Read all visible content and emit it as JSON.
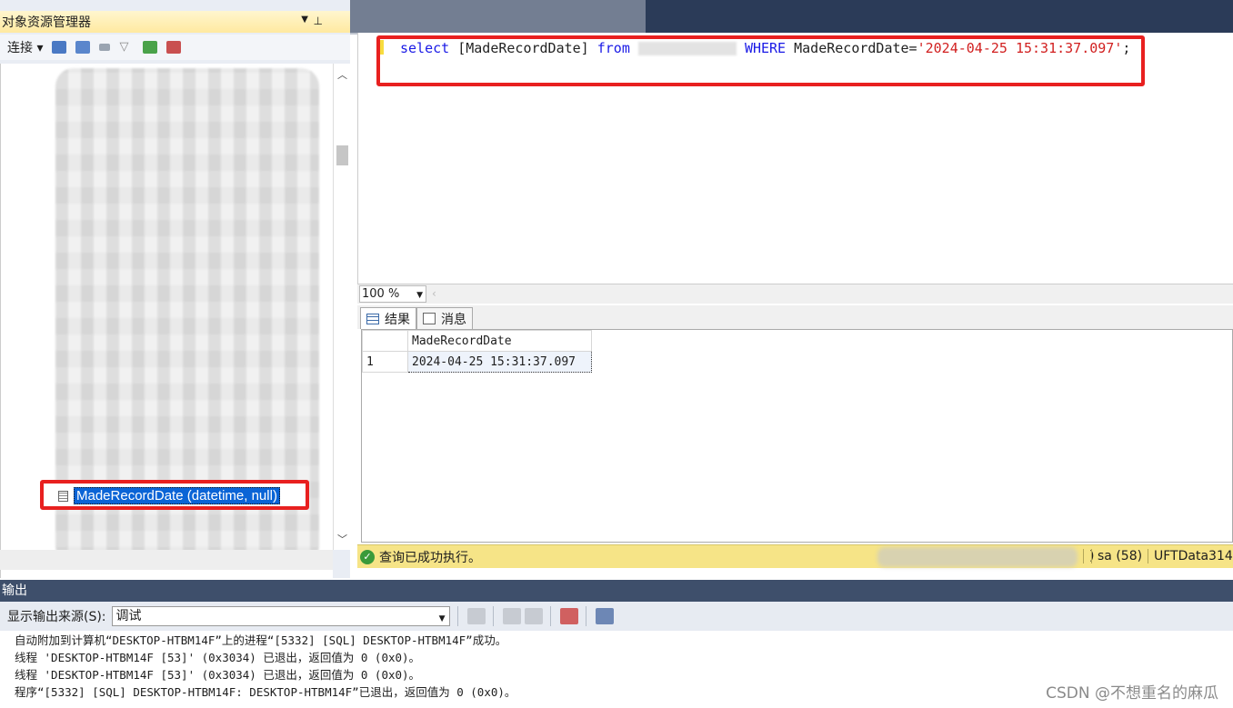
{
  "object_explorer": {
    "title": "对象资源管理器",
    "connect_label": "连接",
    "selected_node": "MadeRecordDate (datetime, null)"
  },
  "editor": {
    "kw_select": "select",
    "column": "[MadeRecordDate]",
    "kw_from": "from",
    "kw_where": "WHERE",
    "where_col": "MadeRecordDate=",
    "literal": "'2024-04-25 15:31:37.097'",
    "terminator": ";"
  },
  "zoom": {
    "value": "100 %"
  },
  "tabs": [
    {
      "label": "结果"
    },
    {
      "label": "消息"
    }
  ],
  "results": {
    "column_header": "MadeRecordDate",
    "rows": [
      {
        "row_num": "1",
        "value": "2024-04-25 15:31:37.097"
      }
    ]
  },
  "status": {
    "message": "查询已成功执行。",
    "user": "sa (58)",
    "database": "UFTData314"
  },
  "output": {
    "title": "输出",
    "source_label": "显示输出来源(S):",
    "source_value": "调试",
    "lines": [
      "自动附加到计算机“DESKTOP-HTBM14F”上的进程“[5332] [SQL] DESKTOP-HTBM14F”成功。",
      "线程 'DESKTOP-HTBM14F [53]' (0x3034) 已退出，返回值为 0 (0x0)。",
      "线程 'DESKTOP-HTBM14F [53]' (0x3034) 已退出，返回值为 0 (0x0)。",
      "程序“[5332] [SQL] DESKTOP-HTBM14F: DESKTOP-HTBM14F”已退出，返回值为 0 (0x0)。"
    ]
  },
  "watermark": "CSDN @不想重名的麻瓜",
  "colors": {
    "highlight_border": "#e8201f",
    "selection": "#0a64d6",
    "status_bar": "#f6e487",
    "titlebar_dark": "#2b3b58"
  }
}
